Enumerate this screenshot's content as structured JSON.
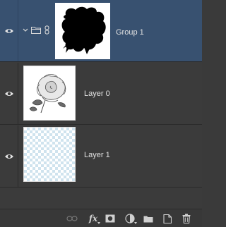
{
  "layers": [
    {
      "name": "Group 1",
      "type": "group",
      "selected": true,
      "visible": true,
      "thumbnail": "group-mask-silhouette"
    },
    {
      "name": "Layer 0",
      "type": "pixel",
      "selected": false,
      "visible": true,
      "thumbnail": "rose-sketch"
    },
    {
      "name": "Layer 1",
      "type": "pixel",
      "selected": false,
      "visible": true,
      "thumbnail": "transparent-checker"
    }
  ],
  "footer": {
    "icons": [
      "link-layers-icon",
      "fx-icon",
      "add-mask-icon",
      "adjustment-layer-icon",
      "new-group-icon",
      "new-layer-icon",
      "trash-icon"
    ],
    "fx_label": "fx"
  },
  "colors": {
    "selected_row": "#385170",
    "panel_bg": "#3b3b3b",
    "text": "#e2e2e2"
  }
}
